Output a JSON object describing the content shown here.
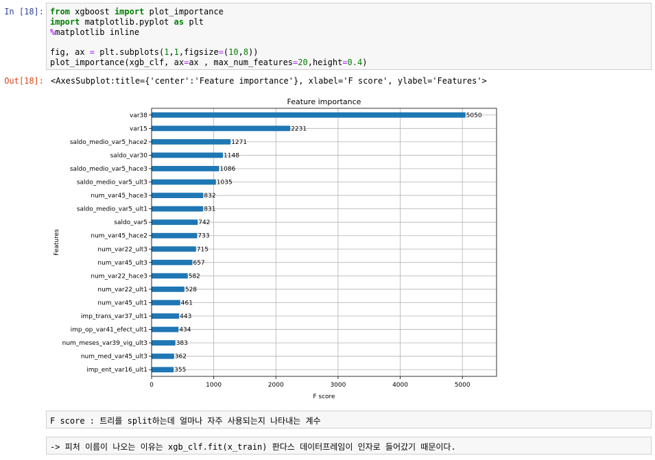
{
  "cells": {
    "in_prompt": "In [18]:",
    "out_prompt": "Out[18]:",
    "code": {
      "line1": {
        "kw1": "from",
        "t1": " xgboost ",
        "kw2": "import",
        "t2": " plot_importance"
      },
      "line2": {
        "kw1": "import",
        "t1": " matplotlib.pyplot ",
        "kw2": "as",
        "t2": " plt"
      },
      "line3": {
        "mag": "%",
        "t1": "matplotlib inline"
      },
      "line5": {
        "t1": "fig, ax ",
        "op1": "=",
        "t2": " plt.subplots(",
        "n1": "1",
        "t3": ",",
        "n2": "1",
        "t4": ",figsize",
        "op2": "=",
        "t5": "(",
        "n3": "10",
        "t6": ",",
        "n4": "8",
        "t7": "))"
      },
      "line6": {
        "t1": "plot_importance(xgb_clf, ax",
        "op1": "=",
        "t2": "ax , max_num_features",
        "op2": "=",
        "n1": "20",
        "t3": ",height",
        "op3": "=",
        "n2": "0.4",
        "t4": ")"
      }
    },
    "output_text": "<AxesSubplot:title={'center':'Feature importance'}, xlabel='F score', ylabel='Features'>",
    "markdown1": "F score : 트리를 split하는데 얼마나 자주 사용되는지 나타내는 계수",
    "markdown2": "-> 피처 이름이 나오는 이유는 xgb_clf.fit(x_train) 판다스 데이터프레임이 인자로 들어갔기 때문이다."
  },
  "chart_data": {
    "type": "bar",
    "orientation": "horizontal",
    "title": "Feature importance",
    "xlabel": "F score",
    "ylabel": "Features",
    "categories": [
      "var38",
      "var15",
      "saldo_medio_var5_hace2",
      "saldo_var30",
      "saldo_medio_var5_hace3",
      "saldo_medio_var5_ult3",
      "num_var45_hace3",
      "saldo_medio_var5_ult1",
      "saldo_var5",
      "num_var45_hace2",
      "num_var22_ult3",
      "num_var45_ult3",
      "num_var22_hace3",
      "num_var22_ult1",
      "num_var45_ult1",
      "imp_trans_var37_ult1",
      "imp_op_var41_efect_ult1",
      "num_meses_var39_vig_ult3",
      "num_med_var45_ult3",
      "imp_ent_var16_ult1"
    ],
    "values": [
      5050,
      2231,
      1271,
      1148,
      1086,
      1035,
      832,
      831,
      742,
      733,
      715,
      657,
      582,
      528,
      461,
      443,
      434,
      383,
      362,
      355
    ],
    "xlim": [
      0,
      5550
    ],
    "xticks": [
      0,
      1000,
      2000,
      3000,
      4000,
      5000
    ],
    "grid": true,
    "bar_color": "#1f77b4"
  }
}
